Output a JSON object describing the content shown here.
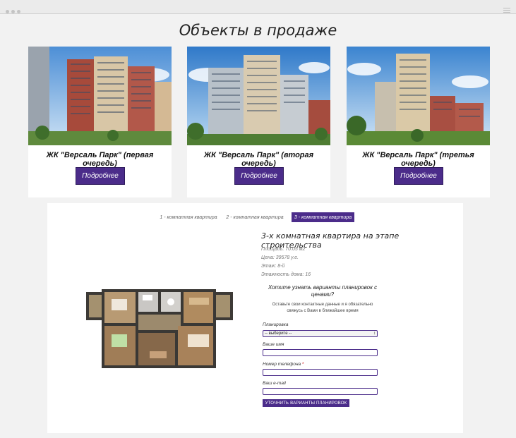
{
  "page": {
    "title": "Объекты в продаже"
  },
  "cards": [
    {
      "title": "ЖК \"Версаль Парк\" (первая очередь)",
      "button": "Подробнее"
    },
    {
      "title": "ЖК \"Версаль Парк\" (вторая очередь)",
      "button": "Подробнее"
    },
    {
      "title": "ЖК \"Версаль Парк\" (третья очередь)",
      "button": "Подробнее"
    }
  ],
  "apartments": {
    "tabs": [
      "1 - комнатная квартира",
      "2 - комнатная квартира",
      "3 - комнатная квартира"
    ],
    "active_tab": "3 - комнатная квартира",
    "title": "3-х комнатная квартира на этапе строительства",
    "specs": [
      "Площадь: 70.05 м2",
      "Цена: 39578 у.е.",
      "Этаж: 8-й",
      "Этажность дома: 16"
    ]
  },
  "form": {
    "question": "Хотите узнать варианты планировок с ценами?",
    "note": "Оставьте свои контактные данные и я обязательно свяжусь с Вами в ближайшее время",
    "layout_label": "Планировка",
    "layout_value": "-- выберите --",
    "name_label": "Ваше имя",
    "phone_label": "Номер телефона",
    "required_mark": "*",
    "email_label": "Ваш e-mail",
    "submit": "УТОЧНИТЬ ВАРИАНТЫ ПЛАНИРОВОК"
  },
  "colors": {
    "accent": "#4b2c8a",
    "background": "#f2f2f2"
  }
}
